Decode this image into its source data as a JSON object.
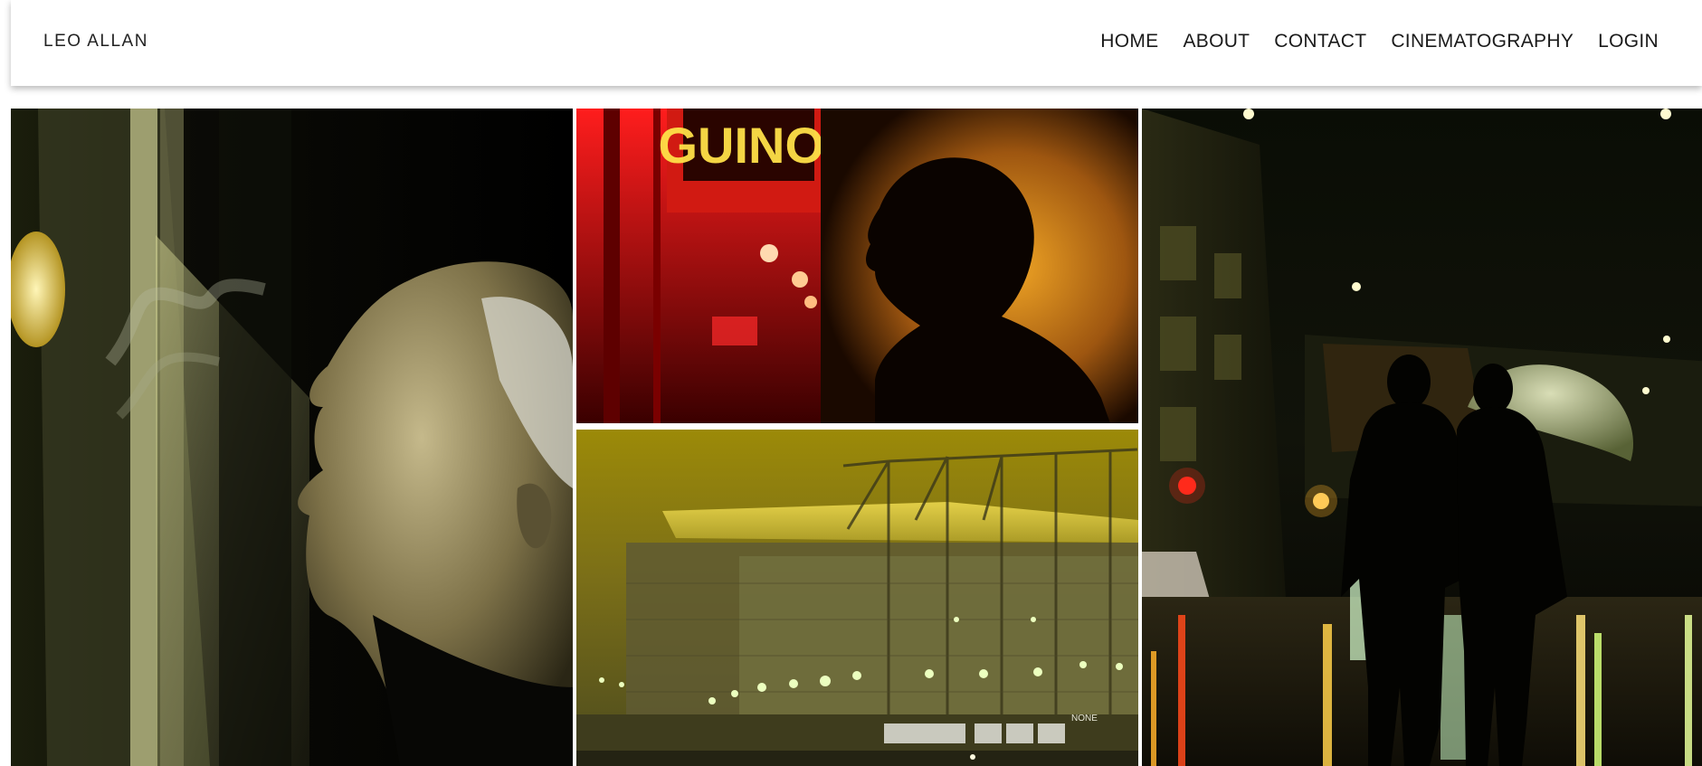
{
  "header": {
    "brand": "LEO ALLAN",
    "nav": [
      {
        "label": "HOME"
      },
      {
        "label": "ABOUT"
      },
      {
        "label": "CONTACT"
      },
      {
        "label": "CINEMATOGRAPHY"
      },
      {
        "label": "LOGIN"
      }
    ]
  },
  "gallery": {
    "photos": [
      {
        "subject": "old-man-smoking-photo"
      },
      {
        "subject": "woman-neon-window-photo"
      },
      {
        "subject": "stadium-fog-photo"
      },
      {
        "subject": "couple-umbrella-night-street-photo"
      }
    ],
    "neon_sign_text": "GUINOI",
    "stadium_sign_text": "NONE"
  }
}
